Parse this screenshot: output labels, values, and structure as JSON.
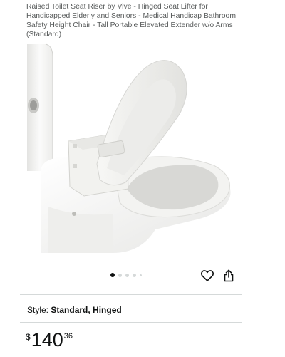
{
  "product": {
    "title": "Raised Toilet Seat Riser by Vive - Hinged Seat Lifter for Handicapped Elderly and Seniors - Medical Handicap Bathroom Safety Height Chair - Tall Portable Elevated Extender w/o Arms (Standard)",
    "image_alt": "White hinged raised toilet seat riser mounted on a toilet",
    "image_count": 5,
    "active_image_index": 0
  },
  "actions": {
    "wishlist_icon": "heart-icon",
    "share_icon": "share-icon"
  },
  "style": {
    "label": "Style:",
    "value": "Standard, Hinged"
  },
  "price": {
    "symbol": "$",
    "whole": "140",
    "fraction": "36"
  }
}
